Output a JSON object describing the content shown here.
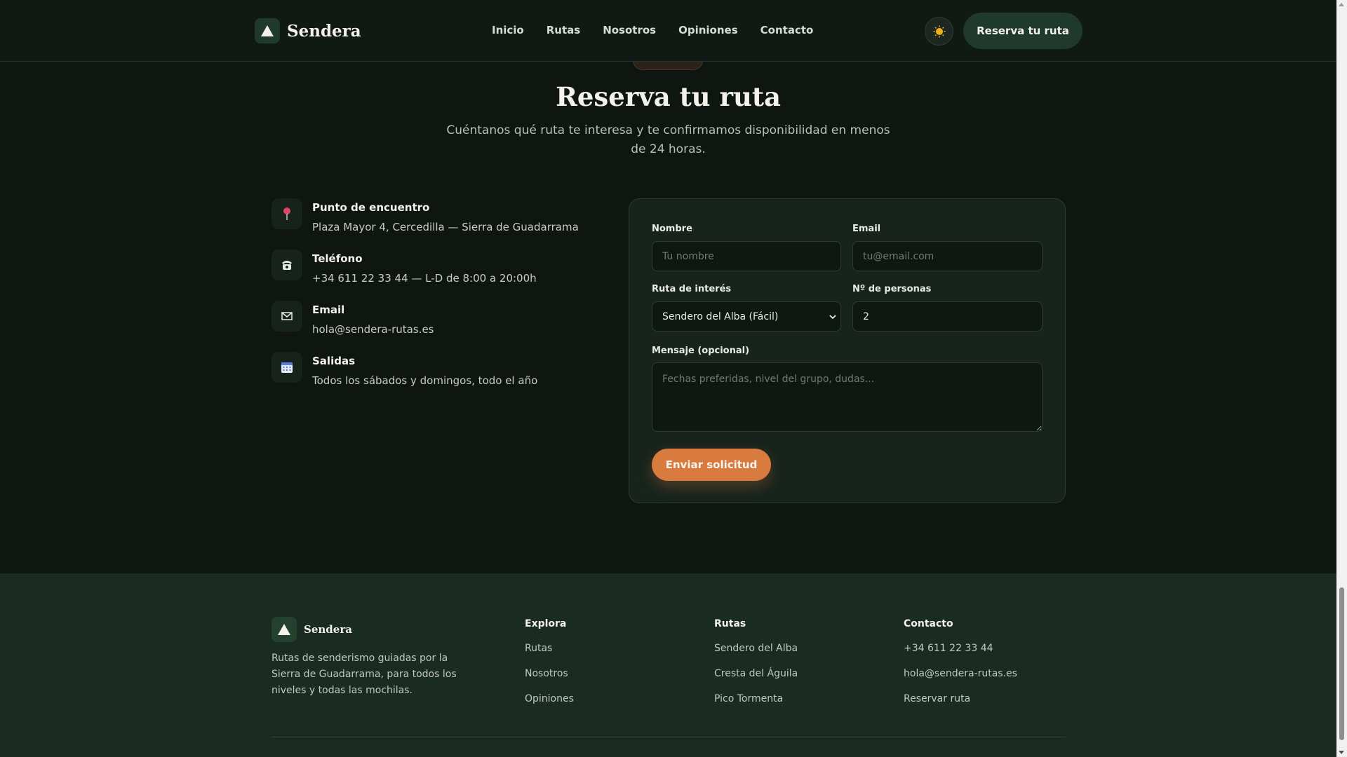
{
  "header": {
    "brand": "Sendera",
    "nav": [
      "Inicio",
      "Rutas",
      "Nosotros",
      "Opiniones",
      "Contacto"
    ],
    "cta": "Reserva tu ruta"
  },
  "section": {
    "title": "Reserva tu ruta",
    "subtitle": "Cuéntanos qué ruta te interesa y te confirmamos disponibilidad en menos de 24 horas."
  },
  "contact_info": [
    {
      "icon": "pin-icon",
      "label": "Punto de encuentro",
      "value": "Plaza Mayor 4, Cercedilla — Sierra de Guadarrama"
    },
    {
      "icon": "phone-icon",
      "label": "Teléfono",
      "value": "+34 611 22 33 44 — L-D de 8:00 a 20:00h"
    },
    {
      "icon": "mail-icon",
      "label": "Email",
      "value": "hola@sendera-rutas.es"
    },
    {
      "icon": "calendar-icon",
      "label": "Salidas",
      "value": "Todos los sábados y domingos, todo el año"
    }
  ],
  "form": {
    "name_label": "Nombre",
    "name_placeholder": "Tu nombre",
    "email_label": "Email",
    "email_placeholder": "tu@email.com",
    "route_label": "Ruta de interés",
    "route_selected": "Sendero del Alba (Fácil)",
    "people_label": "Nº de personas",
    "people_value": "2",
    "message_label": "Mensaje (opcional)",
    "message_placeholder": "Fechas preferidas, nivel del grupo, dudas...",
    "submit": "Enviar solicitud"
  },
  "footer": {
    "brand": "Sendera",
    "description": "Rutas de senderismo guiadas por la Sierra de Guadarrama, para todos los niveles y todas las mochilas.",
    "columns": [
      {
        "title": "Explora",
        "links": [
          "Rutas",
          "Nosotros",
          "Opiniones"
        ]
      },
      {
        "title": "Rutas",
        "links": [
          "Sendero del Alba",
          "Cresta del Águila",
          "Pico Tormenta"
        ]
      },
      {
        "title": "Contacto",
        "links": [
          "+34 611 22 33 44",
          "hola@sendera-rutas.es",
          "Reservar ruta"
        ]
      }
    ]
  },
  "colors": {
    "background": "#0f1612",
    "accent": "#d97a3e",
    "brand_green": "#1f3a2c",
    "footer_bg": "#1a2b22"
  }
}
